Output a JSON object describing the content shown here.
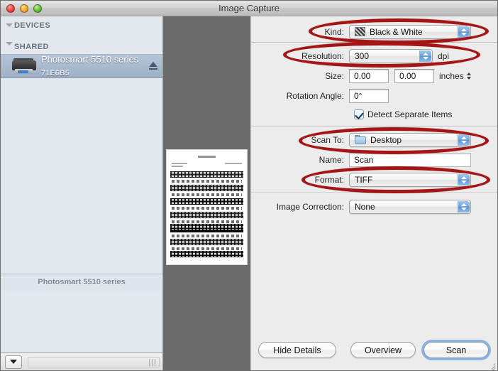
{
  "window": {
    "title": "Image Capture",
    "traffic_lights": [
      "close-button",
      "minimize-button",
      "zoom-button"
    ]
  },
  "sidebar": {
    "sections": [
      {
        "label": "DEVICES",
        "items": []
      },
      {
        "label": "SHARED",
        "items": [
          {
            "name": "Photosmart 5510 series",
            "subtitle": "71E6B5",
            "icon": "printer-icon",
            "eject_icon": "eject-icon",
            "selected": true
          }
        ]
      }
    ],
    "footer_label": "Photosmart 5510 series",
    "action_button_icon": "action-popup-icon",
    "scrollbar_grip_icon": "grip-icon"
  },
  "preview": {
    "thumbnail_alt": "scanned-sheet-music-page"
  },
  "settings": {
    "kind": {
      "label": "Kind:",
      "value": "Black & White",
      "icon": "image-thumbnail-icon"
    },
    "resolution": {
      "label": "Resolution:",
      "value": "300",
      "units": "dpi"
    },
    "size": {
      "label": "Size:",
      "width": "0.00",
      "height": "0.00",
      "units": "inches"
    },
    "rotation": {
      "label": "Rotation Angle:",
      "value": "0°"
    },
    "detect_separate_items": {
      "label": "Detect Separate Items",
      "checked": true
    },
    "scan_to": {
      "label": "Scan To:",
      "value": "Desktop",
      "icon": "folder-icon"
    },
    "name": {
      "label": "Name:",
      "value": "Scan"
    },
    "format": {
      "label": "Format:",
      "value": "TIFF"
    },
    "image_correction": {
      "label": "Image Correction:",
      "value": "None"
    }
  },
  "buttons": {
    "hide_details": "Hide Details",
    "overview": "Overview",
    "scan": "Scan"
  },
  "annotations": {
    "color": "#a41616",
    "highlighted_rows": [
      "Kind",
      "Resolution",
      "Scan To",
      "Format"
    ]
  }
}
